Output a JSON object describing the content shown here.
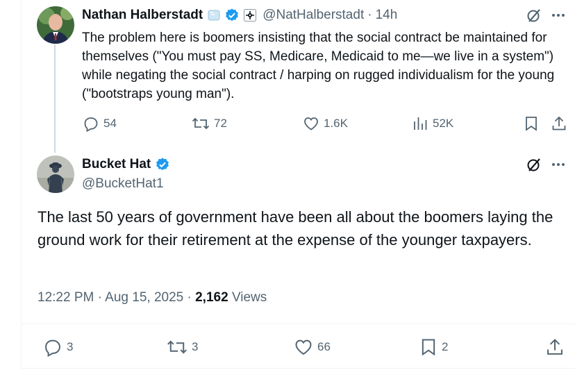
{
  "reply_to": {
    "author_name": "Nathan Halberstadt",
    "handle": "@NatHalberstadt",
    "separator": "·",
    "time": "14h",
    "text": "The problem here is boomers insisting that the social contract be maintained for themselves (\"You must pay SS, Medicare, Medicaid to me—we live in a system\") while negating the social contract / harping on rugged individualism for the young (\"bootstraps young man\").",
    "replies": "54",
    "reposts": "72",
    "likes": "1.6K",
    "views": "52K"
  },
  "tweet": {
    "author_name": "Bucket Hat",
    "handle": "@BucketHat1",
    "text": "The last 50 years of government have been all about the boomers laying the ground work for their retirement at the expense of the younger taxpayers.",
    "time": "12:22 PM",
    "date": "Aug 15, 2025",
    "sep1": "·",
    "sep2": "·",
    "views_count": "2,162",
    "views_label": "Views",
    "replies": "3",
    "reposts": "3",
    "likes": "66",
    "bookmarks": "2"
  },
  "colors": {
    "verified": "#1d9bf0",
    "secondary_text": "#536471",
    "primary_text": "#0f1419"
  },
  "icons": [
    "reply-icon",
    "repost-icon",
    "like-icon",
    "views-icon",
    "bookmark-icon",
    "share-icon",
    "more-icon",
    "grok-icon",
    "verified-icon"
  ]
}
